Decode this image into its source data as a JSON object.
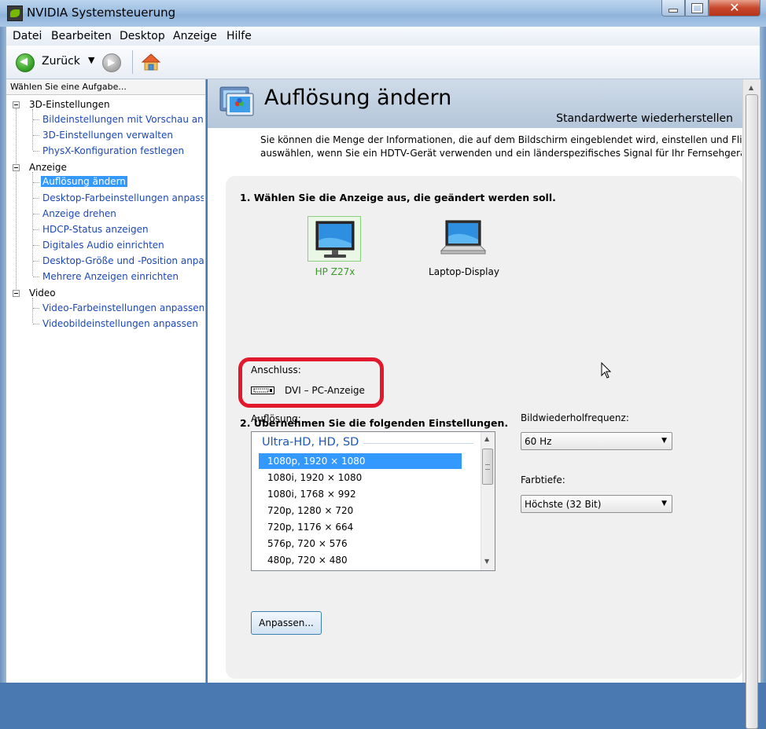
{
  "window": {
    "title": "NVIDIA Systemsteuerung"
  },
  "menu": [
    "Datei",
    "Bearbeiten",
    "Desktop",
    "Anzeige",
    "Hilfe"
  ],
  "toolbar": {
    "back_label": "Zurück"
  },
  "sidebar": {
    "header": "Wählen Sie eine Aufgabe...",
    "categories": [
      {
        "label": "3D-Einstellungen",
        "items": [
          "Bildeinstellungen mit Vorschau anpassen",
          "3D-Einstellungen verwalten",
          "PhysX-Konfiguration festlegen"
        ]
      },
      {
        "label": "Anzeige",
        "items": [
          "Auflösung ändern",
          "Desktop-Farbeinstellungen anpassen",
          "Anzeige drehen",
          "HDCP-Status anzeigen",
          "Digitales Audio einrichten",
          "Desktop-Größe und -Position anpassen",
          "Mehrere Anzeigen einrichten"
        ]
      },
      {
        "label": "Video",
        "items": [
          "Video-Farbeinstellungen anpassen",
          "Videobildeinstellungen anpassen"
        ]
      }
    ],
    "selected": "Auflösung ändern"
  },
  "page": {
    "title": "Auflösung ändern",
    "restore_link": "Standardwerte wiederherstellen",
    "intro_line1": "Sie können die Menge der Informationen, die auf dem Bildschirm eingeblendet wird, einstellen und Flimm",
    "intro_line2": "auswählen, wenn Sie ein HDTV-Gerät verwenden und ein länderspezifisches Signal für Ihr Fernsehgerät"
  },
  "step1": {
    "title": "1. Wählen Sie die Anzeige aus, die geändert werden soll.",
    "displays": [
      {
        "label": "HP Z27x",
        "selected": true
      },
      {
        "label": "Laptop-Display",
        "selected": false
      }
    ]
  },
  "step2": {
    "title": "2. Übernehmen Sie die folgenden Einstellungen.",
    "connector_label": "Anschluss:",
    "connector_value": "DVI – PC-Anzeige",
    "resolution_label": "Auflösung:",
    "resolution_group": "Ultra-HD, HD, SD",
    "resolutions": [
      "1080p, 1920 × 1080",
      "1080i, 1920 × 1080",
      "1080i, 1768 × 992",
      "720p, 1280 × 720",
      "720p, 1176 × 664",
      "576p, 720 × 576",
      "480p, 720 × 480"
    ],
    "selected_resolution": "1080p, 1920 × 1080",
    "refresh_label": "Bildwiederholfrequenz:",
    "refresh_value": "60 Hz",
    "depth_label": "Farbtiefe:",
    "depth_value": "Höchste (32 Bit)",
    "customize_button": "Anpassen..."
  },
  "colors": {
    "highlight": "#e2192d",
    "selection": "#3399ff",
    "link": "#1b48b8",
    "nvidia_green": "#3a9b2a"
  }
}
